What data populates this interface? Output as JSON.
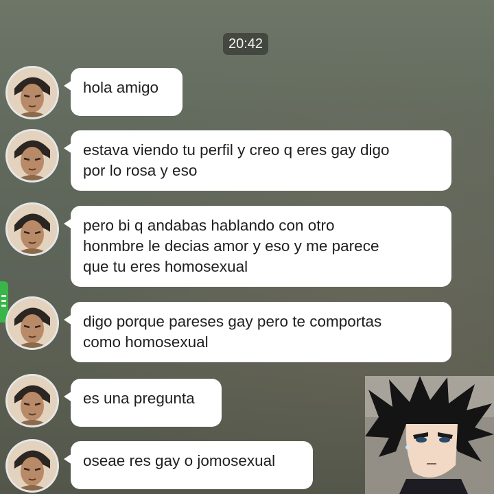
{
  "chat": {
    "timestamp": "20:42",
    "messages": [
      {
        "lines": [
          "hola amigo"
        ]
      },
      {
        "lines": [
          "estava viendo tu perfil y creo q eres gay digo",
          "por lo rosa y eso"
        ]
      },
      {
        "lines": [
          "pero bi q andabas hablando con otro",
          "honmbre le decias amor y eso y me parece",
          "que tu eres homosexual"
        ]
      },
      {
        "lines": [
          "digo porque pareses gay pero te comportas",
          "como homosexual"
        ]
      },
      {
        "lines": [
          "es una pregunta"
        ]
      },
      {
        "lines": [
          "oseae res gay o jomosexual"
        ]
      }
    ]
  },
  "colors": {
    "bubble": "#ffffff",
    "side_tab": "#39b54a"
  },
  "icons": {
    "avatar": "anime-character-avatar",
    "overlay": "anime-reaction-image",
    "side_tab": "menu-icon"
  }
}
